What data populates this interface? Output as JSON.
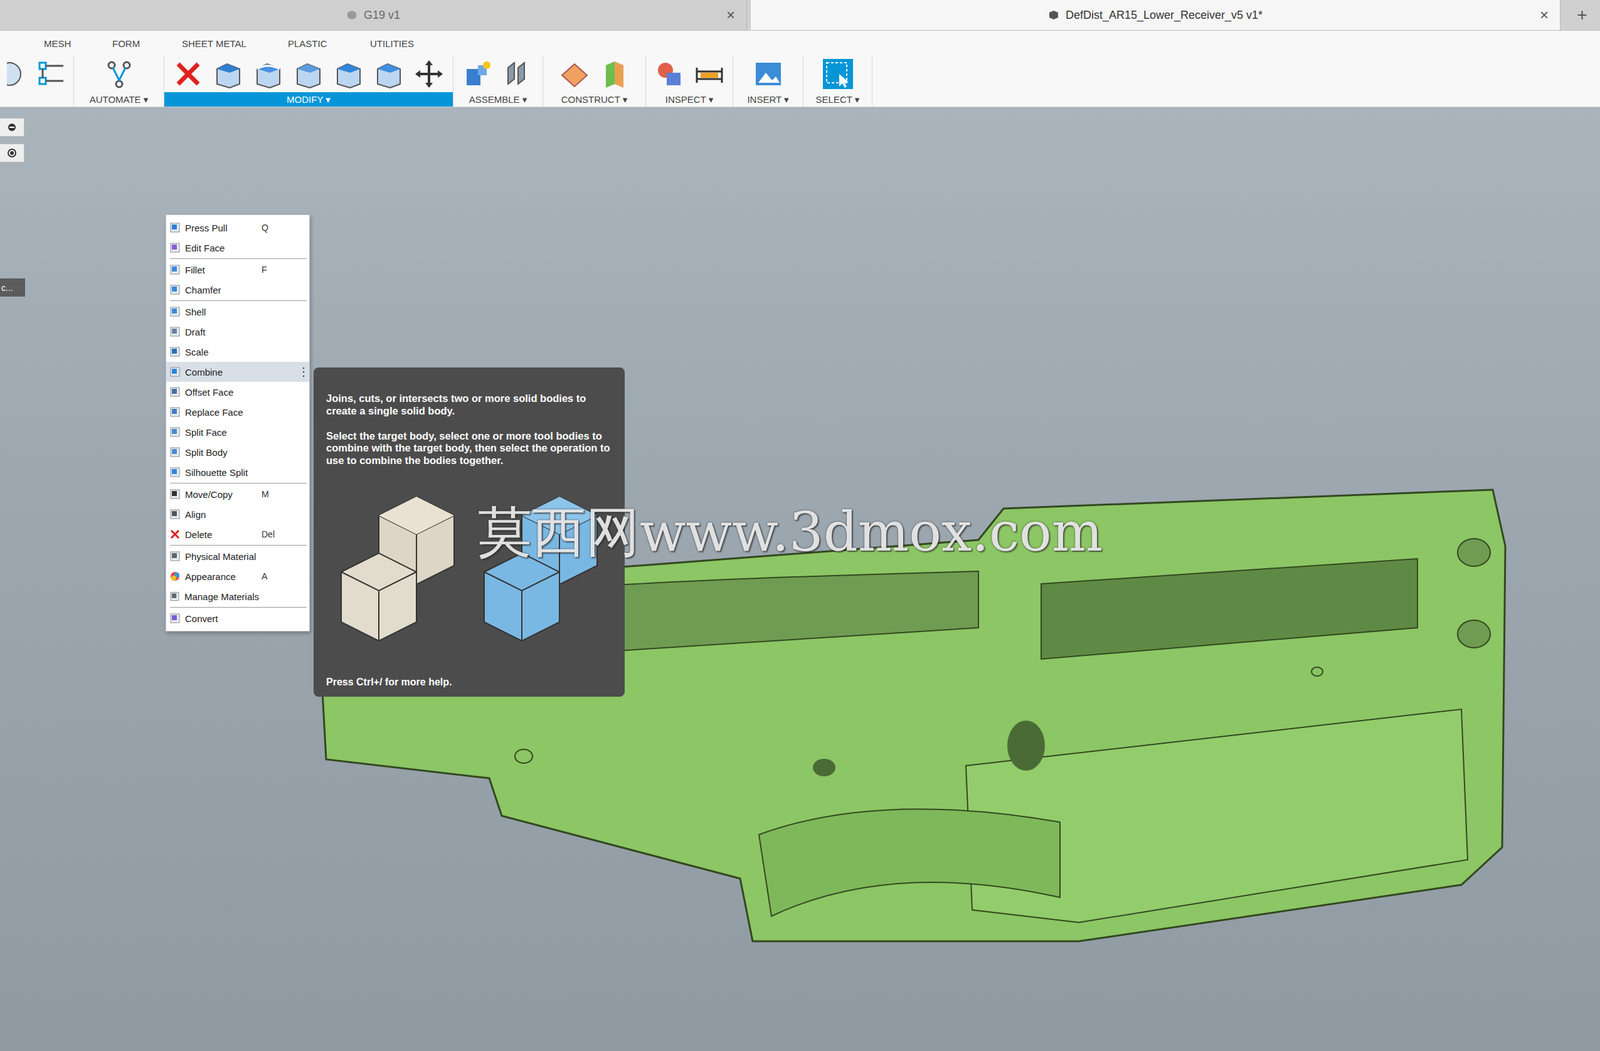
{
  "window": {
    "tabs": [
      {
        "label": "G19 v1",
        "selected": false,
        "close": "×"
      },
      {
        "label": "DefDist_AR15_Lower_Receiver_v5 v1*",
        "selected": true,
        "close": "×"
      }
    ],
    "new_tab": "+"
  },
  "toolbar": {
    "workspace_tabs": [
      {
        "label": "MESH",
        "selected": false
      },
      {
        "label": "FORM",
        "selected": false
      },
      {
        "label": "SHEET METAL",
        "selected": false
      },
      {
        "label": "PLASTIC",
        "selected": false
      },
      {
        "label": "UTILITIES",
        "selected": false
      }
    ],
    "groups": [
      {
        "label": "AUTOMATE ▾",
        "selected": false
      },
      {
        "label": "MODIFY ▾",
        "selected": true
      },
      {
        "label": "ASSEMBLE ▾",
        "selected": false
      },
      {
        "label": "CONSTRUCT ▾",
        "selected": false
      },
      {
        "label": "INSPECT ▾",
        "selected": false
      },
      {
        "label": "INSERT ▾",
        "selected": false
      },
      {
        "label": "SELECT ▾",
        "selected": false
      }
    ]
  },
  "menu": {
    "items": [
      {
        "label": "Press Pull",
        "shortcut": "Q",
        "selected": false,
        "separator_after": false
      },
      {
        "label": "Edit Face",
        "shortcut": "",
        "selected": false,
        "separator_after": true
      },
      {
        "label": "Fillet",
        "shortcut": "F",
        "selected": false,
        "separator_after": false
      },
      {
        "label": "Chamfer",
        "shortcut": "",
        "selected": false,
        "separator_after": true
      },
      {
        "label": "Shell",
        "shortcut": "",
        "selected": false,
        "separator_after": false
      },
      {
        "label": "Draft",
        "shortcut": "",
        "selected": false,
        "separator_after": false
      },
      {
        "label": "Scale",
        "shortcut": "",
        "selected": false,
        "separator_after": false
      },
      {
        "label": "Combine",
        "shortcut": "",
        "selected": true,
        "separator_after": false,
        "more": "⋮"
      },
      {
        "label": "Offset Face",
        "shortcut": "",
        "selected": false,
        "separator_after": false
      },
      {
        "label": "Replace Face",
        "shortcut": "",
        "selected": false,
        "separator_after": false
      },
      {
        "label": "Split Face",
        "shortcut": "",
        "selected": false,
        "separator_after": false
      },
      {
        "label": "Split Body",
        "shortcut": "",
        "selected": false,
        "separator_after": false
      },
      {
        "label": "Silhouette Split",
        "shortcut": "",
        "selected": false,
        "separator_after": true
      },
      {
        "label": "Move/Copy",
        "shortcut": "M",
        "selected": false,
        "separator_after": false
      },
      {
        "label": "Align",
        "shortcut": "",
        "selected": false,
        "separator_after": false
      },
      {
        "label": "Delete",
        "shortcut": "Del",
        "selected": false,
        "separator_after": true
      },
      {
        "label": "Physical Material",
        "shortcut": "",
        "selected": false,
        "separator_after": false
      },
      {
        "label": "Appearance",
        "shortcut": "A",
        "selected": false,
        "separator_after": false
      },
      {
        "label": "Manage Materials",
        "shortcut": "",
        "selected": false,
        "separator_after": true
      },
      {
        "label": "Convert",
        "shortcut": "",
        "selected": false,
        "separator_after": false
      }
    ]
  },
  "tooltip": {
    "paragraphs": [
      "Joins, cuts, or intersects two or more solid bodies to create a single solid body.",
      "Select the target body, select one or more tool bodies to combine with the target body, then select the operation to use to combine the bodies together."
    ],
    "footer": "Press Ctrl+/ for more help."
  },
  "left_panel": {
    "label": "c..."
  },
  "watermark": "莫西网www.3dmox.com"
}
